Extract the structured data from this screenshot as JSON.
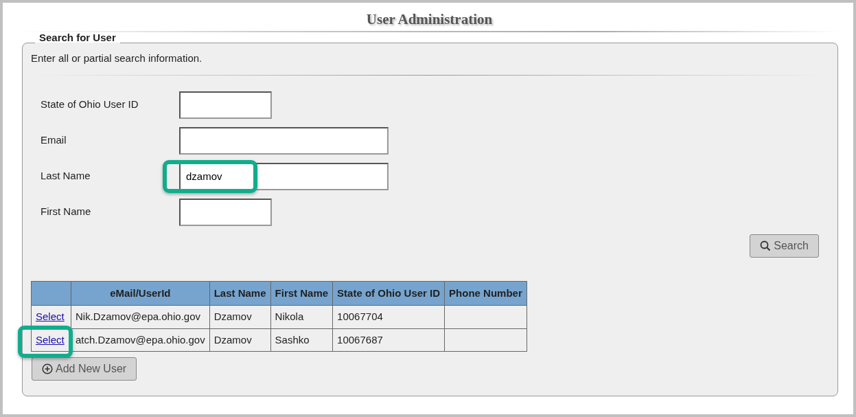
{
  "title": "User Administration",
  "search_panel": {
    "legend": "Search for User",
    "instructions": "Enter all or partial search information.",
    "fields": [
      {
        "label": "State of Ohio User ID",
        "kind": "short",
        "highlighted": false
      },
      {
        "label": "Email",
        "kind": "long",
        "highlighted": false
      },
      {
        "label": "Last Name",
        "value": "dzamov",
        "kind": "long",
        "highlighted": true
      },
      {
        "label": "First Name",
        "kind": "short",
        "highlighted": false
      }
    ],
    "search_button": "Search",
    "table": {
      "columns": [
        null,
        "eMail/UserId",
        "Last Name",
        "First Name",
        "State of Ohio User ID",
        "Phone Number"
      ],
      "rows": [
        {
          "highlighted": false,
          "cells": [
            "Select",
            "Nik.Dzamov@epa.ohio.gov",
            "Dzamov",
            "Nikola",
            "10067704",
            null
          ]
        },
        {
          "highlighted": true,
          "cells": [
            "Select",
            "atch.Dzamov@epa.ohio.gov",
            "Dzamov",
            "Sashko",
            "10067687",
            null
          ]
        }
      ]
    },
    "add_button": "Add New User"
  }
}
